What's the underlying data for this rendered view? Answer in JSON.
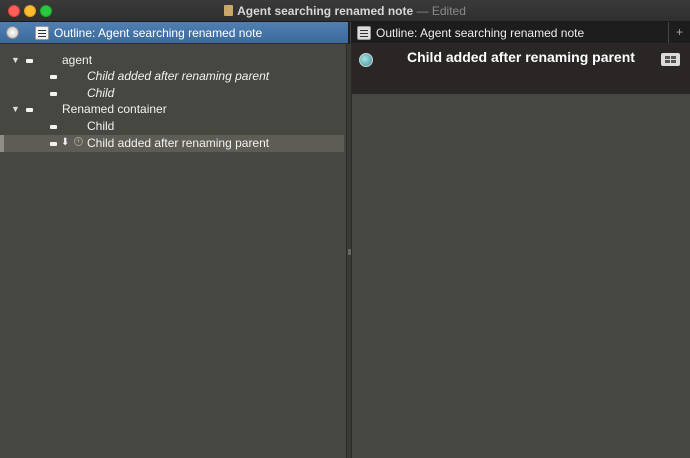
{
  "window": {
    "title": "Agent searching renamed note",
    "separator": "—",
    "status": "Edited"
  },
  "tabs": [
    {
      "label": "Outline: Agent searching renamed note",
      "active": true
    },
    {
      "label": "Outline: Agent searching renamed note",
      "active": false
    }
  ],
  "tab_add_label": "+",
  "outline": {
    "rows": [
      {
        "text": "agent",
        "expanded": true,
        "style": "normal"
      },
      {
        "text": "Child added after renaming parent",
        "style": "italic"
      },
      {
        "text": "Child",
        "style": "italic"
      },
      {
        "text": "Renamed container",
        "expanded": true,
        "style": "normal"
      },
      {
        "text": "Child",
        "style": "normal"
      },
      {
        "text": "Child added after renaming parent",
        "style": "normal",
        "selected": true
      }
    ],
    "disclosure_glyph": "▼",
    "arrow_glyph": "⬇",
    "add_glyph": "+"
  },
  "note": {
    "title": "Child added after renaming parent"
  },
  "colors": {
    "tab_active": "#4a78aa",
    "pane_bg": "#474741",
    "note_header_bg": "#2a2625",
    "badge": "#6bbcc0"
  }
}
